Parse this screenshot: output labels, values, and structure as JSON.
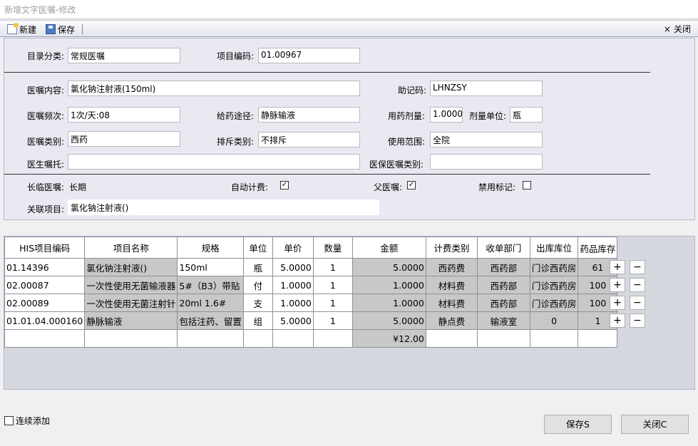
{
  "window": {
    "title": "新增文字医嘱-修改"
  },
  "toolbar": {
    "new_label": "新建",
    "save_label": "保存",
    "close_label": "关闭",
    "close_glyph": "×"
  },
  "form": {
    "catalog_label": "目录分类:",
    "catalog_value": "常规医嘱",
    "item_code_label": "项目编码:",
    "item_code_value": "01.00967",
    "content_label": "医嘱内容:",
    "content_value": "氯化钠注射液(150ml)",
    "mnemonic_label": "助记码:",
    "mnemonic_value": "LHNZSY",
    "freq_label": "医嘱频次:",
    "freq_value": "1次/天:08",
    "route_label": "给药途径:",
    "route_value": "静脉输液",
    "dose_label": "用药剂量:",
    "dose_value": "1.0000",
    "dose_unit_label": "剂量单位:",
    "dose_unit_value": "瓶",
    "category_label": "医嘱类别:",
    "category_value": "西药",
    "exclusion_label": "排斥类别:",
    "exclusion_value": "不排斥",
    "scope_label": "使用范围:",
    "scope_value": "全院",
    "entrust_label": "医生嘱托:",
    "entrust_value": "",
    "insurance_label": "医保医嘱类别:",
    "insurance_value": "",
    "term_label": "长临医嘱:",
    "term_value": "长期",
    "auto_billing_label": "自动计费:",
    "auto_billing_checked": true,
    "parent_label": "父医嘱:",
    "parent_checked": true,
    "disabled_label": "禁用标记:",
    "disabled_checked": false,
    "related_label": "关联项目:",
    "related_value": "氯化钠注射液()",
    "check_glyph": "✓"
  },
  "grid": {
    "columns": [
      "HIS项目编码",
      "项目名称",
      "规格",
      "单位",
      "单价",
      "数量",
      "金额",
      "计费类别",
      "收单部门",
      "出库库位",
      "药品库存"
    ],
    "rows": [
      [
        "01.14396",
        "氯化钠注射液()",
        "150ml",
        "瓶",
        "5.0000",
        "1",
        "5.0000",
        "西药费",
        "西药部",
        "门诊西药房",
        "61"
      ],
      [
        "02.00087",
        "一次性使用无菌输液器",
        "5#（B3）带贴",
        "付",
        "1.0000",
        "1",
        "1.0000",
        "材料费",
        "西药部",
        "门诊西药房",
        "100"
      ],
      [
        "02.00089",
        "一次性使用无菌注射针",
        "20ml  1.6#",
        "支",
        "1.0000",
        "1",
        "1.0000",
        "材料费",
        "西药部",
        "门诊西药房",
        "100"
      ],
      [
        "01.01.04.000160",
        "静脉输液",
        "包括注药、留置",
        "组",
        "5.0000",
        "1",
        "5.0000",
        "静点费",
        "输液室",
        "0",
        "1"
      ]
    ],
    "total": "¥12.00",
    "plus_glyph": "+",
    "minus_glyph": "−"
  },
  "footer": {
    "continuous_add_label": "连续添加",
    "save_button": "保存S",
    "close_button": "关闭C"
  }
}
